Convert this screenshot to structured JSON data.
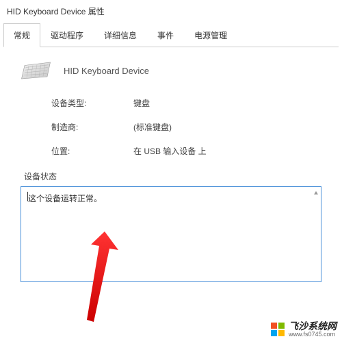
{
  "window": {
    "title": "HID Keyboard Device 属性"
  },
  "tabs": {
    "general": "常规",
    "driver": "驱动程序",
    "details": "详细信息",
    "events": "事件",
    "power": "电源管理"
  },
  "device": {
    "name": "HID Keyboard Device"
  },
  "properties": {
    "type_label": "设备类型:",
    "type_value": "键盘",
    "manufacturer_label": "制造商:",
    "manufacturer_value": "(标准键盘)",
    "location_label": "位置:",
    "location_value": "在 USB 输入设备 上"
  },
  "status": {
    "label": "设备状态",
    "text": "这个设备运转正常。"
  },
  "watermark": {
    "title": "飞沙系统网",
    "url": "www.fs0745.com"
  }
}
